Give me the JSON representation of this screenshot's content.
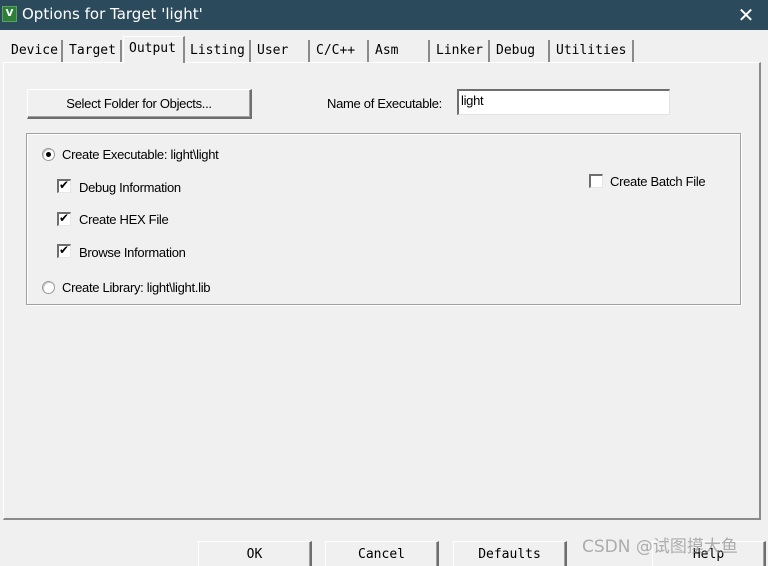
{
  "window": {
    "title": "Options for Target 'light'",
    "app_icon": "keil-uvision-icon",
    "close_glyph": "✕"
  },
  "tabs": [
    {
      "label": "Device",
      "active": false
    },
    {
      "label": "Target",
      "active": false
    },
    {
      "label": "Output",
      "active": true
    },
    {
      "label": "Listing",
      "active": false
    },
    {
      "label": "User",
      "active": false
    },
    {
      "label": "C/C++",
      "active": false
    },
    {
      "label": "Asm",
      "active": false
    },
    {
      "label": "Linker",
      "active": false
    },
    {
      "label": "Debug",
      "active": false
    },
    {
      "label": "Utilities",
      "active": false
    }
  ],
  "output": {
    "select_folder_label": "Select Folder for Objects...",
    "name_of_executable_label": "Name of Executable:",
    "name_of_executable_value": "light",
    "create_executable": {
      "label": "Create Executable:  light\\light",
      "selected": true
    },
    "debug_information": {
      "label": "Debug Information",
      "checked": true
    },
    "create_hex_file": {
      "label": "Create HEX File",
      "checked": true
    },
    "browse_information": {
      "label": "Browse Information",
      "checked": true
    },
    "create_batch_file": {
      "label": "Create Batch File",
      "checked": false
    },
    "create_library": {
      "label": "Create Library:  light\\light.lib",
      "selected": false
    }
  },
  "buttons": {
    "ok": "OK",
    "cancel": "Cancel",
    "defaults": "Defaults",
    "help": "Help"
  },
  "watermark": "CSDN @试图摸大鱼"
}
